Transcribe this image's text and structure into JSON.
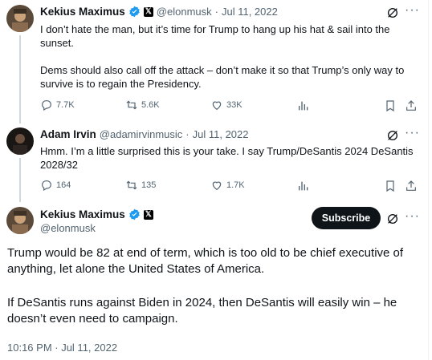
{
  "tweets": [
    {
      "name": "Kekius Maximus",
      "handle": "@elonmusk",
      "date": "Jul 11, 2022",
      "text_p1": "I don’t hate the man, but it’s time for Trump to hang up his hat & sail into the sunset.",
      "text_p2": "Dems should also call off the attack – don’t make it so that Trump’s only way to survive is to regain the Presidency.",
      "replies": "7.7K",
      "retweets": "5.6K",
      "likes": "33K"
    },
    {
      "name": "Adam Irvin",
      "handle": "@adamirvinmusic",
      "date": "Jul 11, 2022",
      "text_p1": "Hmm. I’m a little surprised this is your take. I say Trump/DeSantis 2024 DeSantis 2028/32",
      "replies": "164",
      "retweets": "135",
      "likes": "1.7K"
    }
  ],
  "main_tweet": {
    "name": "Kekius Maximus",
    "handle": "@elonmusk",
    "subscribe_label": "Subscribe",
    "text_p1": "Trump would be 82 at end of term, which is too old to be chief executive of anything, let alone the United States of America.",
    "text_p2": "If DeSantis runs against Biden in 2024, then DeSantis will easily win – he doesn’t even need to campaign.",
    "timestamp": "10:16 PM · Jul 11, 2022"
  },
  "separator": "·",
  "x_badge": "𝕏",
  "more_glyph": "···",
  "colors": {
    "verified": "#1d9bf0",
    "text": "#0f1419",
    "muted": "#536471"
  },
  "icons": [
    "reply-icon",
    "retweet-icon",
    "like-icon",
    "views-icon",
    "bookmark-icon",
    "share-icon",
    "grok-icon",
    "more-icon",
    "verified-icon"
  ]
}
